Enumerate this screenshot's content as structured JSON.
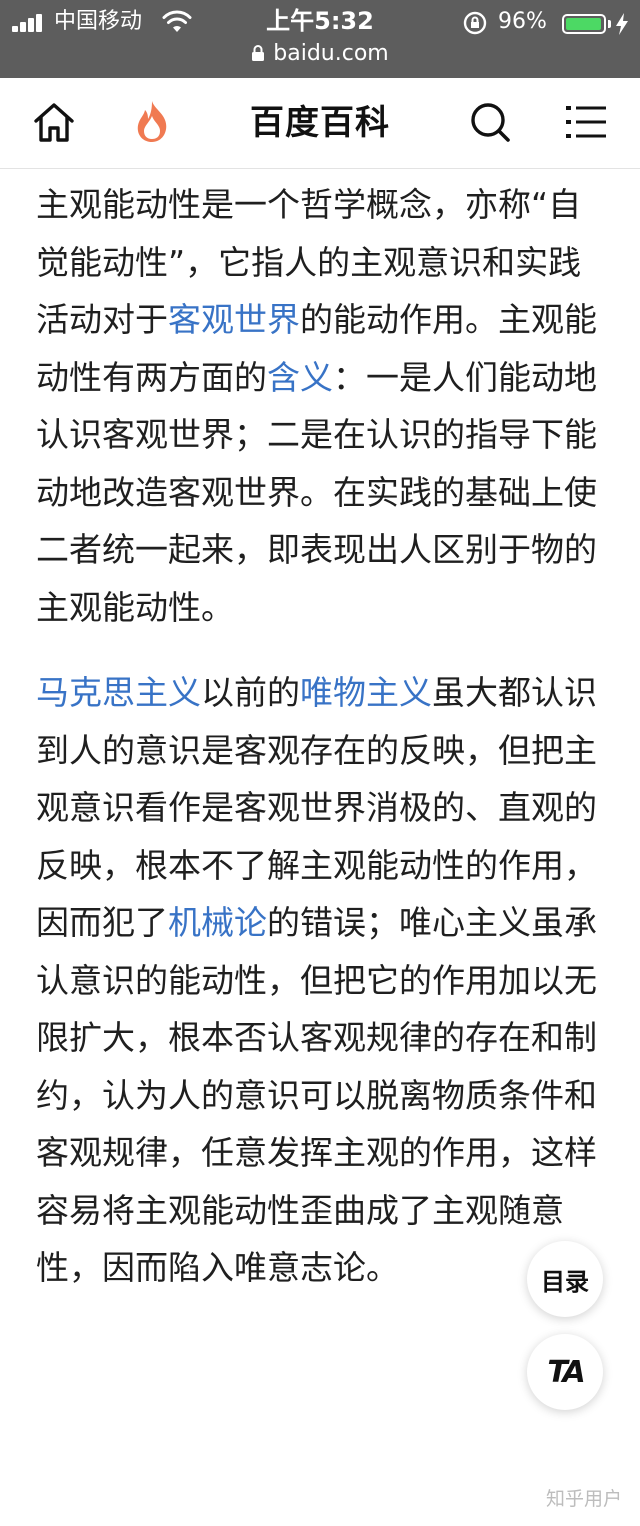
{
  "status_bar": {
    "carrier": "中国移动",
    "time": "上午5:32",
    "battery_percent": "96%",
    "battery_level": 0.96,
    "url": "baidu.com"
  },
  "nav": {
    "title": "百度百科"
  },
  "article": {
    "p1": {
      "t1": "主观能动性是一个哲学概念，亦称“自觉能动性”，它指人的主观意识和实践活动对于",
      "l1": "客观世界",
      "t2": "的能动作用。主观能动性有两方面的",
      "l2": "含义",
      "t3": "：一是人们能动地认识客观世界；二是在认识的指导下能动地改造客观世界。在实践的基础上使二者统一起来，即表现出人区别于物的主观能动性。"
    },
    "p2": {
      "l1": "马克思主义",
      "t1": "以前的",
      "l2": "唯物主义",
      "t2": "虽大都认识到人的意识是客观存在的反映，但把主观意识看作是客观世界消极的、直观的反映，根本不了解主观能动性的作用，因而犯了",
      "l3": "机械论",
      "t3": "的错误；唯心主义虽承认意识的能动性，但把它的作用加以无限扩大，根本否认客观规律的存在和制约，认为人的意识可以脱离物质条件和客观规律，任意发挥主观的作用，这样容易将主观能动性歪曲成了主观随意性，因而陷入唯意志论。"
    }
  },
  "floating": {
    "toc_label": "目录",
    "ta_label": "TA"
  },
  "watermark": "知乎用户",
  "colors": {
    "link": "#3873c6",
    "text": "#1f1f1f",
    "status_bar_bg": "#5d5d5d",
    "battery": "#4cd964",
    "fire_icon": "#f07a52"
  }
}
